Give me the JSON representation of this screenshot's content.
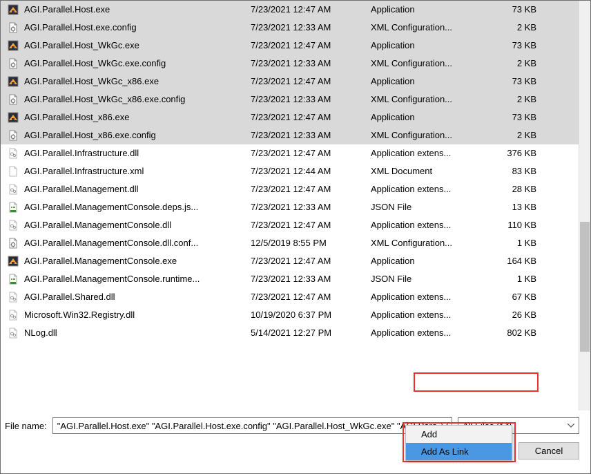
{
  "files": [
    {
      "icon": "exe",
      "name": "AGI.Parallel.Host.exe",
      "date": "7/23/2021 12:47 AM",
      "type": "Application",
      "size": "73 KB",
      "sel": true
    },
    {
      "icon": "config",
      "name": "AGI.Parallel.Host.exe.config",
      "date": "7/23/2021 12:33 AM",
      "type": "XML Configuration...",
      "size": "2 KB",
      "sel": true
    },
    {
      "icon": "exe",
      "name": "AGI.Parallel.Host_WkGc.exe",
      "date": "7/23/2021 12:47 AM",
      "type": "Application",
      "size": "73 KB",
      "sel": true
    },
    {
      "icon": "config",
      "name": "AGI.Parallel.Host_WkGc.exe.config",
      "date": "7/23/2021 12:33 AM",
      "type": "XML Configuration...",
      "size": "2 KB",
      "sel": true
    },
    {
      "icon": "exe",
      "name": "AGI.Parallel.Host_WkGc_x86.exe",
      "date": "7/23/2021 12:47 AM",
      "type": "Application",
      "size": "73 KB",
      "sel": true
    },
    {
      "icon": "config",
      "name": "AGI.Parallel.Host_WkGc_x86.exe.config",
      "date": "7/23/2021 12:33 AM",
      "type": "XML Configuration...",
      "size": "2 KB",
      "sel": true
    },
    {
      "icon": "exe",
      "name": "AGI.Parallel.Host_x86.exe",
      "date": "7/23/2021 12:47 AM",
      "type": "Application",
      "size": "73 KB",
      "sel": true
    },
    {
      "icon": "config",
      "name": "AGI.Parallel.Host_x86.exe.config",
      "date": "7/23/2021 12:33 AM",
      "type": "XML Configuration...",
      "size": "2 KB",
      "sel": true
    },
    {
      "icon": "dll",
      "name": "AGI.Parallel.Infrastructure.dll",
      "date": "7/23/2021 12:47 AM",
      "type": "Application extens...",
      "size": "376 KB",
      "sel": false
    },
    {
      "icon": "xml",
      "name": "AGI.Parallel.Infrastructure.xml",
      "date": "7/23/2021 12:44 AM",
      "type": "XML Document",
      "size": "83 KB",
      "sel": false
    },
    {
      "icon": "dll",
      "name": "AGI.Parallel.Management.dll",
      "date": "7/23/2021 12:47 AM",
      "type": "Application extens...",
      "size": "28 KB",
      "sel": false
    },
    {
      "icon": "json",
      "name": "AGI.Parallel.ManagementConsole.deps.js...",
      "date": "7/23/2021 12:33 AM",
      "type": "JSON File",
      "size": "13 KB",
      "sel": false
    },
    {
      "icon": "dll",
      "name": "AGI.Parallel.ManagementConsole.dll",
      "date": "7/23/2021 12:47 AM",
      "type": "Application extens...",
      "size": "110 KB",
      "sel": false
    },
    {
      "icon": "config",
      "name": "AGI.Parallel.ManagementConsole.dll.conf...",
      "date": "12/5/2019 8:55 PM",
      "type": "XML Configuration...",
      "size": "1 KB",
      "sel": false
    },
    {
      "icon": "exe",
      "name": "AGI.Parallel.ManagementConsole.exe",
      "date": "7/23/2021 12:47 AM",
      "type": "Application",
      "size": "164 KB",
      "sel": false
    },
    {
      "icon": "json",
      "name": "AGI.Parallel.ManagementConsole.runtime...",
      "date": "7/23/2021 12:33 AM",
      "type": "JSON File",
      "size": "1 KB",
      "sel": false
    },
    {
      "icon": "dll",
      "name": "AGI.Parallel.Shared.dll",
      "date": "7/23/2021 12:47 AM",
      "type": "Application extens...",
      "size": "67 KB",
      "sel": false
    },
    {
      "icon": "dll",
      "name": "Microsoft.Win32.Registry.dll",
      "date": "10/19/2020 6:37 PM",
      "type": "Application extens...",
      "size": "26 KB",
      "sel": false
    },
    {
      "icon": "dll",
      "name": "NLog.dll",
      "date": "5/14/2021 12:27 PM",
      "type": "Application extens...",
      "size": "802 KB",
      "sel": false
    }
  ],
  "footer": {
    "fileNameLabel": "File name:",
    "fileNameValue": "\"AGI.Parallel.Host.exe\" \"AGI.Parallel.Host.exe.config\" \"AGI.Parallel.Host_WkGc.exe\" \"AGI.Parallel.Host_WkGc.exe.config\"",
    "filter": "All Files (*.*)",
    "addLabel": "Add",
    "cancelLabel": "Cancel"
  },
  "dropdown": {
    "item1": "Add",
    "item2": "Add As Link"
  }
}
